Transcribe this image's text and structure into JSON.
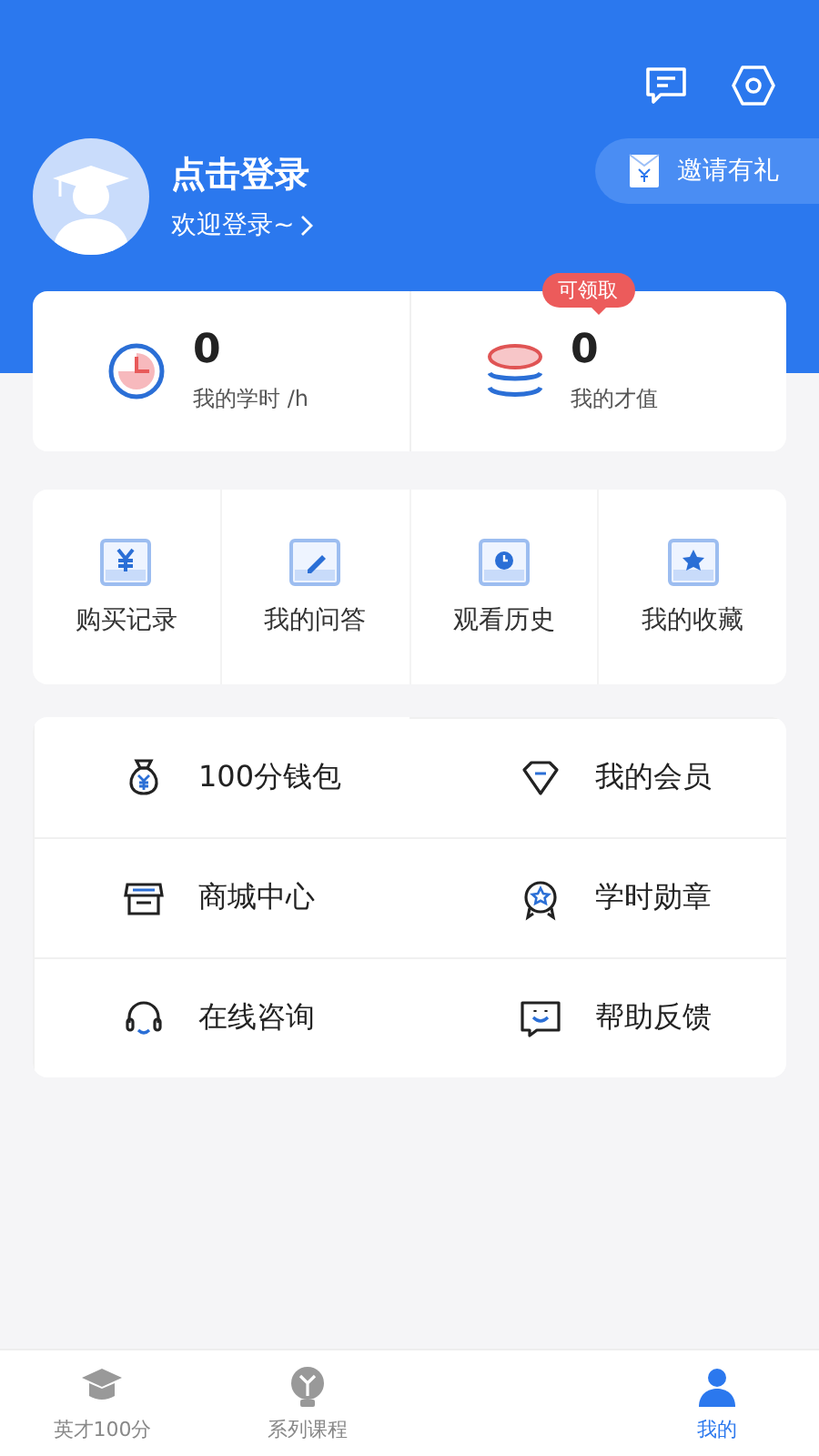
{
  "header": {
    "title": "点击登录",
    "subtitle": "欢迎登录~",
    "invite": "邀请有礼"
  },
  "stats": [
    {
      "value": "0",
      "label": "我的学时 /h"
    },
    {
      "value": "0",
      "label": "我的才值",
      "badge": "可领取"
    }
  ],
  "shortcuts": [
    {
      "label": "购买记录"
    },
    {
      "label": "我的问答"
    },
    {
      "label": "观看历史"
    },
    {
      "label": "我的收藏"
    }
  ],
  "menu": [
    {
      "label": "100分钱包"
    },
    {
      "label": "我的会员"
    },
    {
      "label": "商城中心"
    },
    {
      "label": "学时勋章"
    },
    {
      "label": "在线咨询"
    },
    {
      "label": "帮助反馈"
    }
  ],
  "tabs": [
    {
      "label": "英才100分",
      "selected": false
    },
    {
      "label": "系列课程",
      "selected": false
    },
    {
      "label": "我的",
      "selected": true
    }
  ]
}
